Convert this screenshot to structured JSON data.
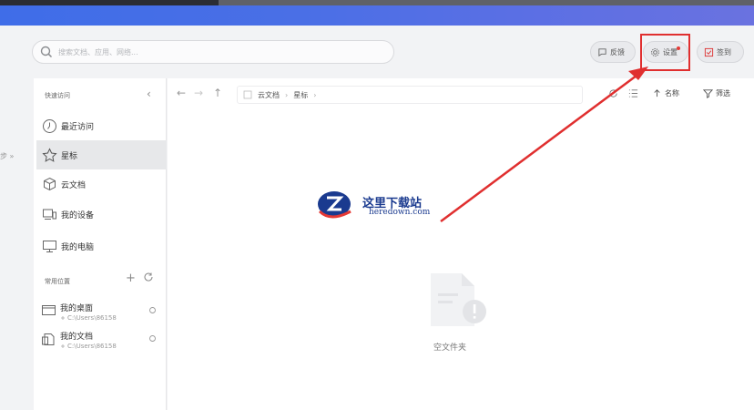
{
  "search": {
    "placeholder": "搜索文档、应用、网络..."
  },
  "toolbar": {
    "feedback_label": "反馈",
    "settings_label": "设置",
    "signin_label": "签到"
  },
  "sidebar": {
    "quick_access_title": "快速访问",
    "items": [
      {
        "label": "最近访问",
        "icon": "clock-icon"
      },
      {
        "label": "星标",
        "icon": "star-icon"
      },
      {
        "label": "云文档",
        "icon": "cube-icon"
      },
      {
        "label": "我的设备",
        "icon": "devices-icon"
      },
      {
        "label": "我的电脑",
        "icon": "monitor-icon"
      }
    ],
    "common_title": "常用位置",
    "places": [
      {
        "name": "我的桌面",
        "path": "C:\\Users\\86158"
      },
      {
        "name": "我的文档",
        "path": "C:\\Users\\86158"
      }
    ],
    "cut_text": "步 »"
  },
  "breadcrumb": {
    "root": "云文档",
    "current": "星标"
  },
  "main_toolbar": {
    "sort_label": "名称",
    "filter_label": "筛选"
  },
  "empty": {
    "label": "空文件夹"
  },
  "watermark": {
    "title": "这里下载站",
    "url": "heredown.com"
  },
  "colors": {
    "accent": "#4a6fe6",
    "highlight": "#e02f2f"
  }
}
